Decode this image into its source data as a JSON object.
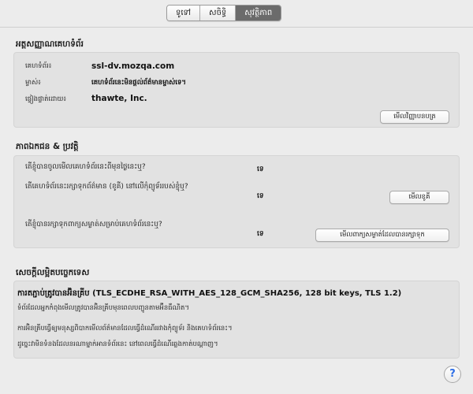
{
  "tabs": [
    {
      "label": "ទូទៅ",
      "active": false
    },
    {
      "label": "សចិទ្ធិ",
      "active": false
    },
    {
      "label": "សុវត្ថិភាព",
      "active": true
    }
  ],
  "identity": {
    "title": "អត្តសញ្ញាណគេហទំព័រ",
    "website_label": "គេហទំព័រ៖",
    "website_value": "ssl-dv.mozqa.com",
    "owner_label": "ម្ចាស់៖",
    "owner_value": "គេហទំព័រនេះមិនផ្ដល់ព័ត៌មានម្ចាស់ទេ។",
    "verified_label": "ផ្ទៀងផ្ទាត់ដោយ៖",
    "verified_value": "thawte, Inc.",
    "view_cert_button": "មើលវិញ្ញាបនបត្រ"
  },
  "privacy": {
    "title": "ភាពឯកជន & ប្រវត្តិ",
    "q1": "តើខ្ញុំបានចូលមើលគេហទំព័រនេះពីមុនថ្ងៃនេះឬ?",
    "a1": "ទេ",
    "q2": "តើគេហទំព័រនេះរក្សាទុកព័ត៌មាន (ខូគី) នៅលើកុំព្យូទ័ររបស់ខ្ញុំឬ?",
    "a2": "ទេ",
    "cookies_button": "មើលខូគី",
    "q3": "តើខ្ញុំបានរក្សាទុកពាក្យសម្ងាត់សម្រាប់គេហទំព័រនេះឬ?",
    "a3": "ទេ",
    "passwords_button": "មើលពាក្យសម្ងាត់ដែលបានរក្សាទុក"
  },
  "technical": {
    "title": "សេចក្ដីលម្អិតបច្ចេកទេស",
    "heading": "ការតភ្ជាប់ត្រូវបានអ៊ិនគ្រីប (TLS_ECDHE_RSA_WITH_AES_128_GCM_SHA256, 128 bit keys, TLS 1.2)",
    "line1": "ទំព័រដែលអ្នកកំពុងមើលត្រូវបានអ៊ិនគ្រីបមុនពេលបញ្ជូនតាមអ៊ីនធឺណិត។",
    "line2": "ការអ៊ិនគ្រីបធ្វើឲ្យមនុស្សពិបាកមើលព័ត៌មានដែលធ្វើដំណើររវាងកុំព្យូទ័រ និងគេហទំព័រនេះ។",
    "line3": "ដូច្នេះវាមិនទំនងដែលនរណាម្នាក់អានទំព័រនេះ នៅពេលធ្វើដំណើរឆ្លងកាត់បណ្ដាញ។"
  },
  "help_label": "?"
}
